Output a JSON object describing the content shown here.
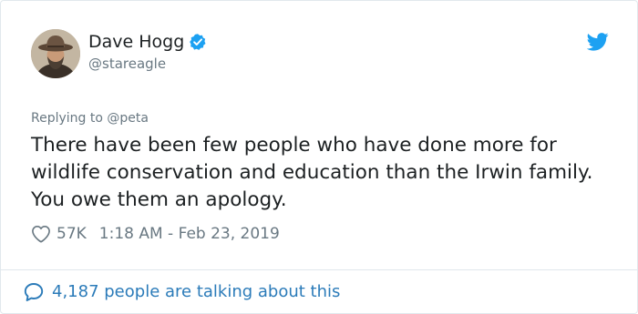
{
  "tweet": {
    "author": {
      "display_name": "Dave Hogg",
      "handle": "@stareagle",
      "verified": true,
      "avatar_icon": "user-avatar-photo"
    },
    "brand_icon": "twitter-bird-icon",
    "replying_prefix": "Replying to",
    "replying_to": "@peta",
    "text": "There have been few people who have done more for wildlife conservation and education than the Irwin family. You owe them an apology.",
    "likes": "57K",
    "timestamp": "1:18 AM - Feb 23, 2019",
    "talking_about": "4,187 people are talking about this"
  },
  "colors": {
    "text": "#1c2022",
    "secondary": "#697882",
    "link": "#2b7bb9",
    "twitter_blue": "#1da1f2",
    "border": "#e1e8ed"
  }
}
